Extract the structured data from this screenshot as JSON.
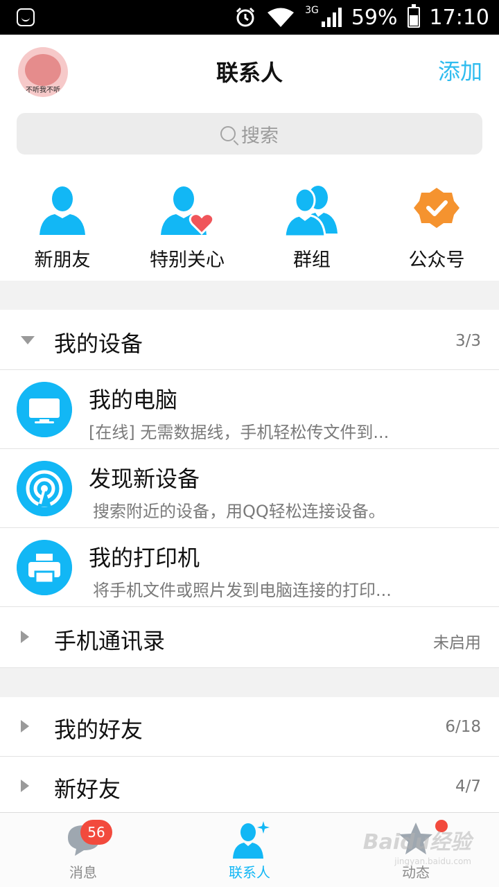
{
  "status_bar": {
    "battery_percent": "59%",
    "time": "17:10",
    "network": "3G",
    "battery_level": 0.59
  },
  "header": {
    "title": "联系人",
    "add_label": "添加",
    "avatar_caption": "不听我不听"
  },
  "search": {
    "placeholder": "搜索"
  },
  "quick_entries": [
    {
      "label": "新朋友",
      "icon": "person-icon"
    },
    {
      "label": "特别关心",
      "icon": "person-heart-icon"
    },
    {
      "label": "群组",
      "icon": "group-icon"
    },
    {
      "label": "公众号",
      "icon": "badge-check-icon"
    }
  ],
  "groups": {
    "devices": {
      "title": "我的设备",
      "count": "3/3"
    },
    "phone_contacts": {
      "title": "手机通讯录",
      "status": "未启用"
    },
    "friends": {
      "title": "我的好友",
      "count": "6/18"
    },
    "new_friends": {
      "title": "新好友",
      "count": "4/7"
    }
  },
  "devices": [
    {
      "title": "我的电脑",
      "subtitle": "[在线] 无需数据线，手机轻松传文件到...",
      "icon": "monitor-icon"
    },
    {
      "title": "发现新设备",
      "subtitle": "搜索附近的设备，用QQ轻松连接设备。",
      "icon": "radar-icon"
    },
    {
      "title": "我的打印机",
      "subtitle": "将手机文件或照片发到电脑连接的打印...",
      "icon": "printer-icon"
    }
  ],
  "tabbar": {
    "messages": {
      "label": "消息",
      "badge": "56"
    },
    "contacts": {
      "label": "联系人"
    },
    "moments": {
      "label": "动态"
    }
  },
  "watermark": {
    "text": "Baidu经验",
    "sub": "jingyan.baidu.com"
  },
  "colors": {
    "accent": "#12b7f5",
    "badge": "#f24a3d",
    "official": "#f5932f",
    "heart": "#f0555a"
  }
}
